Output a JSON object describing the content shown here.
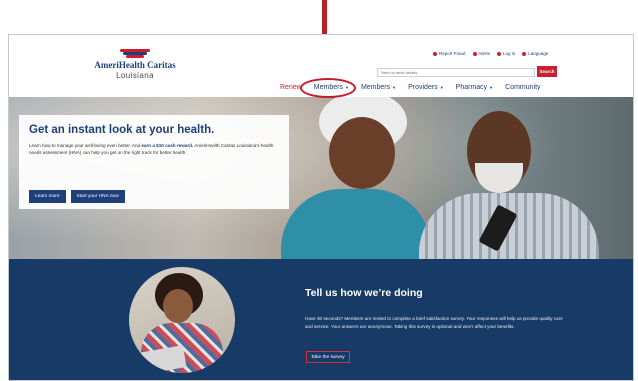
{
  "colors": {
    "brand_navy": "#1d3f7a",
    "brand_red": "#c8202f",
    "survey_band": "#173a67"
  },
  "header": {
    "logo_name": "AmeriHealth Caritas",
    "logo_state": "Louisiana",
    "utility_links": [
      "Report Fraud",
      "Alerts",
      "Log in",
      "Language"
    ],
    "search": {
      "placeholder": "Need to seek details",
      "button_label": "Search"
    },
    "nav": [
      "Renew",
      "Members",
      "Members",
      "Providers",
      "Pharmacy",
      "Community"
    ]
  },
  "hero": {
    "title": "Get an instant look at your health.",
    "text_intro": "Learn how to manage your well-being even better. And",
    "text_bold": "earn a $10 cash reward.",
    "text_rest": "AmeriHealth Caritas Louisiana’s health needs assessment (HNA) can help you get on the right track for better health.",
    "buttons": [
      "Learn more",
      "Start your HNA now"
    ]
  },
  "survey": {
    "title": "Tell us how we’re doing",
    "text": "Have 30 seconds? Members are invited to complete a brief satisfaction survey. Your responses will help us provide quality care and service. Your answers are anonymous. Taking this survey is optional and won’t affect your benefits.",
    "button_label": "Take the survey"
  }
}
